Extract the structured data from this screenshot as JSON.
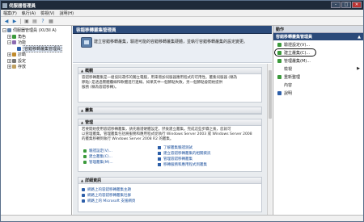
{
  "window": {
    "title": "伺服器管理員"
  },
  "menu": [
    "檔案(F)",
    "執行(A)",
    "檢視(V)",
    "說明(H)"
  ],
  "tree": [
    {
      "label": "伺服器管理員 (XU3II A)",
      "indent": 0,
      "expander": "−",
      "color": "#5c7fa9",
      "selected": false
    },
    {
      "label": "角色",
      "indent": 1,
      "expander": "+",
      "color": "#3b9a3b",
      "selected": false
    },
    {
      "label": "功能",
      "indent": 1,
      "expander": "−",
      "color": "#8c6bb1",
      "selected": false
    },
    {
      "label": "容錯移轉叢集管理員",
      "indent": 2,
      "expander": "",
      "color": "#2c5ea8",
      "selected": true
    },
    {
      "label": "診斷",
      "indent": 1,
      "expander": "+",
      "color": "#c08a2c",
      "selected": false
    },
    {
      "label": "設定",
      "indent": 1,
      "expander": "+",
      "color": "#777777",
      "selected": false
    },
    {
      "label": "存放",
      "indent": 1,
      "expander": "+",
      "color": "#c0a060",
      "selected": false
    }
  ],
  "center": {
    "header": "容錯移轉叢集管理員",
    "banner_text": "建立容錯移轉叢集，驗證可能的容錯移轉叢集硬體，並執行容錯移轉叢集的設定變更。",
    "overview": {
      "title": "概觀",
      "lines": [
        "容錯移轉叢集是一組協同運作的獨立電腦，用來增加伺服器應用程式的可用性。叢集伺服器 (稱為",
        "節點) 是透過實體纜線和軟體進行連線。如果其中一個節點失敗，另一個節點會開始提供",
        "服務 (稱為容錯移轉)。"
      ]
    },
    "clusters": {
      "title": "叢集"
    },
    "management": {
      "title": "管理",
      "lines": [
        "若要開始使用容錯移轉叢集，請先驗證硬體設定，然後建立叢集。完成這些步驟之後，您就可",
        "以管理叢集。管理叢集包括將服務和應用程式從執行 Windows Server 2003 或 Windows Server 2008",
        "的叢集移轉到執行 Windows Server 2008 R2 的叢集。"
      ],
      "left_links": [
        "驗證設定(V)...",
        "建立叢集(C)...",
        "管理叢集(M)..."
      ],
      "right_links": [
        "了解叢集驗證測試",
        "建立容錯移轉叢集的相關資訊",
        "管理容錯移轉叢集",
        "移轉服務和應用程式到叢集"
      ]
    },
    "more_info": {
      "title": "詳細資訊",
      "links": [
        "網路上的容錯移轉叢集主題",
        "網路上的容錯移轉叢集社群",
        "網路上的 Microsoft 支援網頁"
      ]
    }
  },
  "actions": {
    "title": "動作",
    "group": "容錯移轉叢集管理員",
    "items": [
      {
        "label": "驗證設定(V)...",
        "color": "#3b9a3b",
        "submenu": false
      },
      {
        "label": "建立叢集(C)...",
        "color": "#3b9a3b",
        "submenu": false
      },
      {
        "label": "管理叢集(M)...",
        "color": "#3b9a3b",
        "submenu": false
      },
      {
        "label": "檢視",
        "color": "",
        "submenu": true
      },
      {
        "label": "重新整理",
        "color": "#3b9a3b",
        "submenu": false
      },
      {
        "label": "內容",
        "color": "",
        "submenu": false
      },
      {
        "label": "說明",
        "color": "#2c5ea8",
        "submenu": false
      }
    ],
    "highlighted_index": 1
  }
}
